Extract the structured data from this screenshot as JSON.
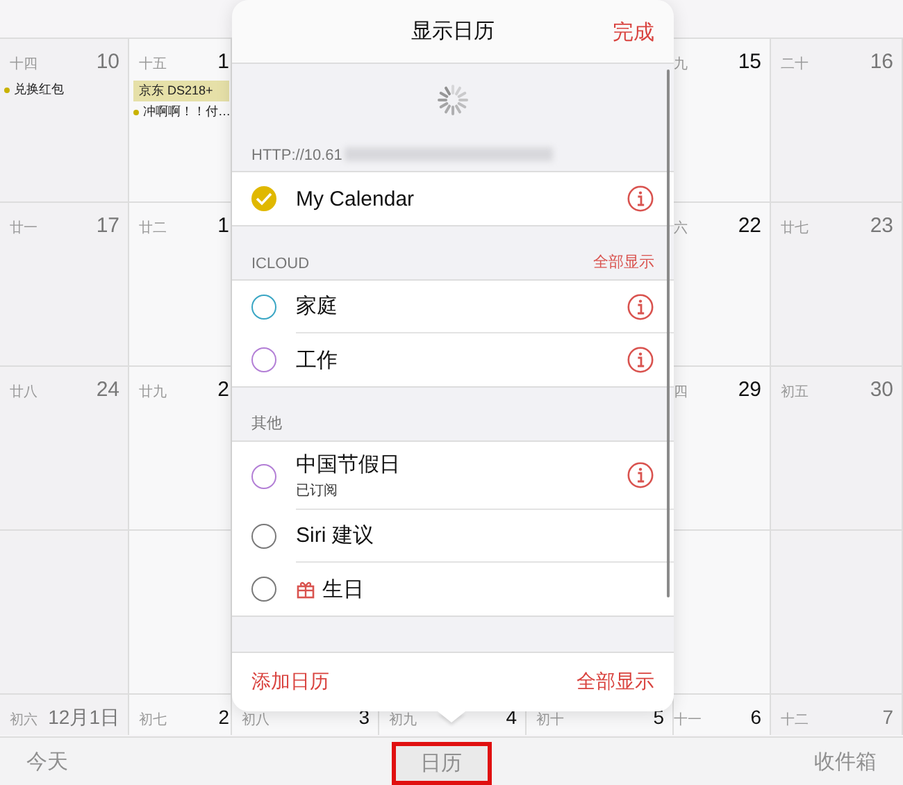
{
  "calendar_grid": {
    "rows": [
      {
        "cells": [
          {
            "lunar": "十四",
            "date": "10",
            "events": [
              {
                "kind": "dot",
                "text": "兑换红包",
                "color": "#c9b200"
              }
            ]
          },
          {
            "lunar": "十五",
            "date": "1",
            "events": [
              {
                "kind": "bar",
                "text": "京东 DS218+",
                "color": "#e6e0a8"
              },
              {
                "kind": "dot",
                "text": "冲啊啊！！付…",
                "color": "#c9b200"
              }
            ]
          },
          {},
          {},
          {},
          {
            "lunar": "九",
            "date": "15"
          },
          {
            "lunar": "二十",
            "date": "16"
          }
        ]
      },
      {
        "cells": [
          {
            "lunar": "廿一",
            "date": "17"
          },
          {
            "lunar": "廿二",
            "date": "1"
          },
          {},
          {},
          {},
          {
            "lunar": "六",
            "date": "22"
          },
          {
            "lunar": "廿七",
            "date": "23"
          }
        ]
      },
      {
        "cells": [
          {
            "lunar": "廿八",
            "date": "24"
          },
          {
            "lunar": "廿九",
            "date": "2"
          },
          {},
          {},
          {},
          {
            "lunar": "四",
            "date": "29"
          },
          {
            "lunar": "初五",
            "date": "30"
          }
        ]
      },
      {
        "cells": [
          {},
          {},
          {},
          {},
          {},
          {},
          {}
        ]
      },
      {
        "cells": [
          {
            "lunar": "初六",
            "date": "12月1日"
          },
          {
            "lunar": "初七",
            "date": "2"
          },
          {
            "lunar": "初八",
            "date": "3"
          },
          {
            "lunar": "初九",
            "date": "4"
          },
          {
            "lunar": "初十",
            "date": "5"
          },
          {
            "lunar": "十一",
            "date": "6"
          },
          {
            "lunar": "十二",
            "date": "7"
          }
        ]
      }
    ]
  },
  "popover": {
    "title": "显示日历",
    "done": "完成",
    "sections": [
      {
        "header": "HTTP://10.61",
        "redacted": true,
        "calendars": [
          {
            "name": "My Calendar",
            "checked": true,
            "color": "#e0b800",
            "info": true
          }
        ]
      },
      {
        "header": "ICLOUD",
        "action": "全部显示",
        "calendars": [
          {
            "name": "家庭",
            "checked": false,
            "color": "#3aa6c4",
            "info": true
          },
          {
            "name": "工作",
            "checked": false,
            "color": "#b37fd6",
            "info": true
          }
        ]
      },
      {
        "header": "其他",
        "calendars": [
          {
            "name": "中国节假日",
            "subtitle": "已订阅",
            "checked": false,
            "color": "#b37fd6",
            "info": true
          },
          {
            "name": "Siri 建议",
            "checked": false,
            "color": "#7a7a7a",
            "info": false
          },
          {
            "name": "生日",
            "kind": "birthday",
            "checked": false,
            "color": "#7a7a7a",
            "info": false
          }
        ]
      }
    ],
    "add": "添加日历",
    "show_all": "全部显示"
  },
  "toolbar": [
    {
      "label": "今天",
      "highlighted": false
    },
    {
      "label": "日历",
      "highlighted": true
    },
    {
      "label": "收件箱",
      "highlighted": false
    }
  ]
}
